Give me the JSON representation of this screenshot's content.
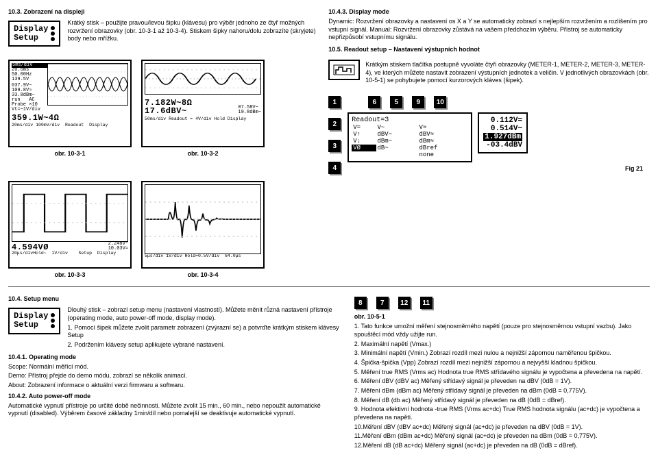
{
  "sec10_3": {
    "title": "10.3. Zobrazení na displeji",
    "intro": "Krátký stisk – použijte pravou/levou šipku (klávesu) pro výběr jednoho ze čtyř možných rozvržení obrazovky (obr. 10-3-1 až 10-3-4). Stiskem šipky nahoru/dolu zobrazíte (skryjete) body nebo mřížku.",
    "display_label": "Display",
    "setup_label": "Setup",
    "fig1": {
      "hdr1": "5ms/div",
      "hdr2": "20.0ms",
      "hdr3": "50.00Hz",
      "hdr4": "139.5V",
      "side": [
        "037.9V~",
        "109.8V≈",
        "33.8dBm~",
        "run   AC",
        "Probe ×10",
        "Vt=~1V/div"
      ],
      "main": "359.1W~4Ω",
      "foot": "20ms/div 100mV/div  Readout  Display",
      "label": "obr. 10-3-1"
    },
    "fig2": {
      "line1": "7.182W~8Ω",
      "line2": "17.6dBV~",
      "side": [
        "07.58V~",
        "19.8dBm~"
      ],
      "foot": "50ms/div Readout = 4V/div Hold Display",
      "label": "obr. 10-3-2"
    },
    "fig3": {
      "main": "4.594VØ",
      "side": [
        "2.248V~",
        "10.03V≈"
      ],
      "foot": "20μs/divHold~  1V/div    Setup  Display",
      "label": "obr. 10-3-3"
    },
    "fig4": {
      "foot": "5μs/div 1V/div Hold=0.5V/div  64.0μs",
      "label": "obr. 10-3-4"
    }
  },
  "sec10_4_3": {
    "title": "10.4.3. Display mode",
    "p1": "Dynamic: Rozvržení obrazovky a nastavení os X a Y se automaticky zobrazí s nejlepším rozvržením a rozlišením pro vstupní signál. Manual: Rozvržení obrazovky zůstává na vašem předchozím výběru. Přístroj se automaticky nepřizpůsobí vstupnímu signálu."
  },
  "sec10_5": {
    "title": "10.5. Readout setup – Nastavení výstupních hodnot",
    "p1": "Krátkým stiskem tlačítka postupně vyvoláte čtyři obrazovky (METER-1, METER-2, METER-3, METER-4), ve kterých můžete nastavit zobrazení výstupních jednotek a veličin. V jednotlivých obrazovkách (obr. 10-5-1) se pohybujete pomocí kurzorových kláves (šipek).",
    "badges_top": [
      "6",
      "5",
      "9",
      "10"
    ],
    "badges_left": [
      "1",
      "2",
      "3",
      "4"
    ],
    "readout": {
      "title": "Readout=3",
      "rows": [
        [
          "V=",
          "V~",
          "V≈"
        ],
        [
          "V↑",
          "dBV~",
          "dBV≈"
        ],
        [
          "V↓",
          "dBm~",
          "dBm≈"
        ],
        [
          "VØ",
          "dB~",
          "dBref"
        ],
        [
          "",
          "",
          "none"
        ]
      ],
      "bot1": "0.112V=",
      "bot2": "0.514V~",
      "bot3": "1.927dBm",
      "bot4": "-03.4dBV"
    },
    "fig21": "Fig 21"
  },
  "sec10_4": {
    "title": "10.4. Setup menu",
    "p1": "Dlouhý stisk – zobrazí setup menu (nastavení vlastností). Můžete měnit různá nastavení přístroje (operating mode, auto power-off mode, display mode).",
    "p2": "1. Pomocí šipek můžete zvolit parametr zobrazení (zvýrazní se) a potvrďte krátkým stiskem klávesy Setup",
    "p3": "2. Podržením klávesy setup aplikujete vybrané nastavení.",
    "s1t": "10.4.1. Operating mode",
    "s1a": "Scope: Normální měřící mód.",
    "s1b": "Demo: Přístroj přejde do demo módu, zobrazí se několik animací.",
    "s1c": "About: Zobrazení informace o aktuální verzi firmwaru a softwaru.",
    "s2t": "10.4.2. Auto power-off mode",
    "s2a": "Automatické vypnutí přístroje po určité době nečinnosti. Můžete zvolit 15 min., 60 min., nebo nepoužít automatické vypnutí (disabled). Výběrem časové základny 1min/díl nebo pomalejší se deaktivuje automatické vypnutí."
  },
  "sec10_5_1": {
    "badges": [
      "8",
      "7",
      "12",
      "11"
    ],
    "label": "obr. 10-5-1",
    "l1": "1. Tato funkce umožní měření stejnosměrného napětí (pouze pro stejnosměrnou vstupní vazbu). Jako spouštěcí mód vždy užijte run.",
    "l2": "2. Maximální napětí (Vmax.)",
    "l3": "3. Minimální napětí (Vmin.) Zobrazí rozdíl mezi nulou a nejnižší zápornou naměřenou špičkou.",
    "l4": "4. Špička-špička (Vpp) Zobrazí rozdíl mezi nejnižší zápornou a nejvyšší kladnou špičkou.",
    "l5": "5. Měření true RMS (Vrms ac) Hodnota true RMS střídavého signálu je vypočtena a převedena na napětí.",
    "l6": "6. Měření dBV (dBV ac) Měřený střídavý signál je převeden na dBV (0dB = 1V).",
    "l7": "7. Měření dBm (dBm ac) Měřený střídavý signál je převeden na dBm (0dB = 0,775V).",
    "l8": "8. Měření dB (db ac) Měřený střídavý signál je převeden na dB (0dB = dBref).",
    "l9": "9. Hodnota efektivní hodnota -true RMS (Vrms ac+dc) True RMS hodnota signálu (ac+dc) je vypočtena a převedena na napětí.",
    "l10": "10.Měření dBV (dBV ac+dc) Měřený signál (ac+dc) je převeden na dBV (0dB = 1V).",
    "l11": "11.Měření dBm (dBm ac+dc) Měřený signál (ac+dc) je převeden na dBm (0dB = 0,775V).",
    "l12": "12.Měření dB (dB ac+dc) Měřený signál (ac+dc) je převeden na dB (0dB = dBref)."
  }
}
